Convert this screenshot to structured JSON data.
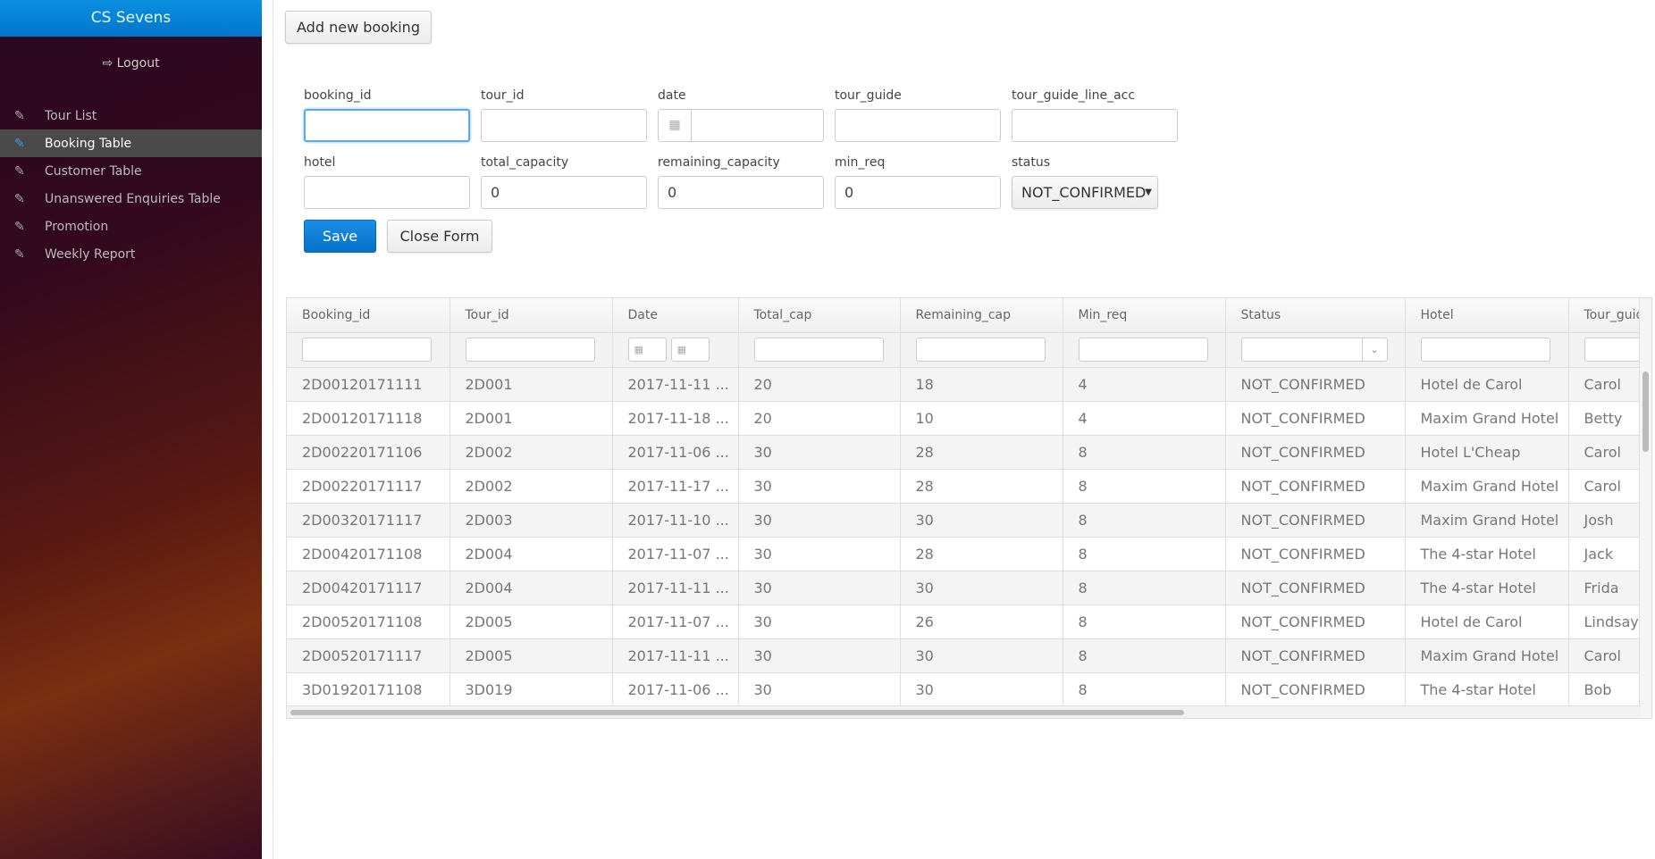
{
  "sidebar": {
    "brand": "CS Sevens",
    "logout": "Logout",
    "items": [
      {
        "label": "Tour List"
      },
      {
        "label": "Booking Table",
        "active": true
      },
      {
        "label": "Customer Table"
      },
      {
        "label": "Unanswered Enquiries Table"
      },
      {
        "label": "Promotion"
      },
      {
        "label": "Weekly Report"
      }
    ]
  },
  "toolbar": {
    "add": "Add new booking"
  },
  "form": {
    "labels": {
      "booking_id": "booking_id",
      "tour_id": "tour_id",
      "date": "date",
      "tour_guide": "tour_guide",
      "tour_guide_line_acc": "tour_guide_line_acc",
      "hotel": "hotel",
      "total_capacity": "total_capacity",
      "remaining_capacity": "remaining_capacity",
      "min_req": "min_req",
      "status": "status"
    },
    "values": {
      "total_capacity": "0",
      "remaining_capacity": "0",
      "min_req": "0",
      "status": "NOT_CONFIRMED"
    },
    "save": "Save",
    "close": "Close Form"
  },
  "table": {
    "columns": [
      "Booking_id",
      "Tour_id",
      "Date",
      "Total_cap",
      "Remaining_cap",
      "Min_req",
      "Status",
      "Hotel",
      "Tour_guid"
    ],
    "rows": [
      [
        "2D00120171111",
        "2D001",
        "2017-11-11 ...",
        "20",
        "18",
        "4",
        "NOT_CONFIRMED",
        "Hotel de Carol",
        "Carol"
      ],
      [
        "2D00120171118",
        "2D001",
        "2017-11-18 ...",
        "20",
        "10",
        "4",
        "NOT_CONFIRMED",
        "Maxim Grand Hotel",
        "Betty"
      ],
      [
        "2D00220171106",
        "2D002",
        "2017-11-06 ...",
        "30",
        "28",
        "8",
        "NOT_CONFIRMED",
        "Hotel L'Cheap",
        "Carol"
      ],
      [
        "2D00220171117",
        "2D002",
        "2017-11-17 ...",
        "30",
        "28",
        "8",
        "NOT_CONFIRMED",
        "Maxim Grand Hotel",
        "Carol"
      ],
      [
        "2D00320171117",
        "2D003",
        "2017-11-10 ...",
        "30",
        "30",
        "8",
        "NOT_CONFIRMED",
        "Maxim Grand Hotel",
        "Josh"
      ],
      [
        "2D00420171108",
        "2D004",
        "2017-11-07 ...",
        "30",
        "28",
        "8",
        "NOT_CONFIRMED",
        "The 4-star Hotel",
        "Jack"
      ],
      [
        "2D00420171117",
        "2D004",
        "2017-11-11 ...",
        "30",
        "30",
        "8",
        "NOT_CONFIRMED",
        "The 4-star Hotel",
        "Frida"
      ],
      [
        "2D00520171108",
        "2D005",
        "2017-11-07 ...",
        "30",
        "26",
        "8",
        "NOT_CONFIRMED",
        "Hotel de Carol",
        "Lindsay"
      ],
      [
        "2D00520171117",
        "2D005",
        "2017-11-11 ...",
        "30",
        "30",
        "8",
        "NOT_CONFIRMED",
        "Maxim Grand Hotel",
        "Carol"
      ],
      [
        "3D01920171108",
        "3D019",
        "2017-11-06 ...",
        "30",
        "30",
        "8",
        "NOT_CONFIRMED",
        "The 4-star Hotel",
        "Bob"
      ]
    ]
  }
}
